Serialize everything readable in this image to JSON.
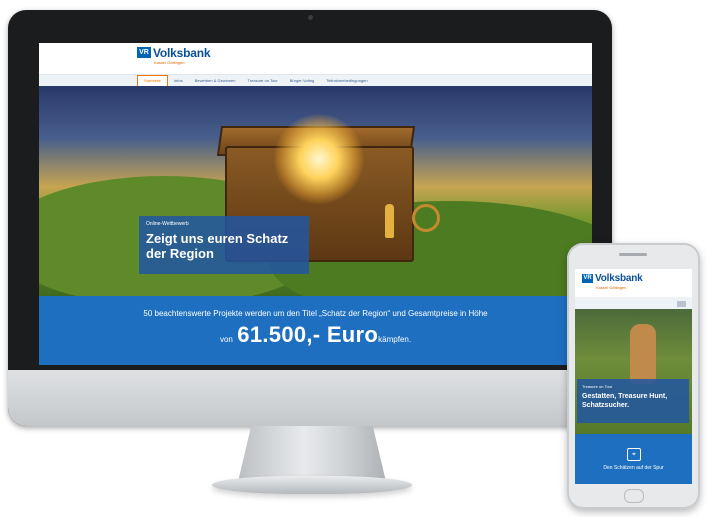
{
  "brand": {
    "name": "Volksbank",
    "sub": "Kassel Göttingen",
    "mark": "VR"
  },
  "nav": {
    "items": [
      {
        "label": "Startseite",
        "active": true
      },
      {
        "label": "Infos"
      },
      {
        "label": "Bewerben & Gewinnen"
      },
      {
        "label": "Treasure on Tour"
      },
      {
        "label": "Bürger-Voting"
      },
      {
        "label": "Teilnahmebedingungen"
      }
    ]
  },
  "hero": {
    "kicker": "Online-Wettbewerb",
    "title": "Zeigt uns euren Schatz der Region"
  },
  "promo": {
    "line": "50 beachtenswerte Projekte werden um den Titel „Schatz der Region“ und Gesamtpreise in Höhe",
    "prefix": "von",
    "amount": "61.500,- Euro",
    "suffix": "kämpfen."
  },
  "phone": {
    "brand": "Volksbank",
    "brand_sub": "Kassel Göttingen",
    "kicker": "Treasure on Tour",
    "title": "Gestatten, Treasure Hunt, Schatzsucher.",
    "footer_label": "Den Schätzen auf der Spur",
    "footer_icon": "map-icon"
  },
  "colors": {
    "brand_blue": "#0066b3",
    "promo_blue": "#1e6fc0",
    "accent_orange": "#f07a00"
  }
}
